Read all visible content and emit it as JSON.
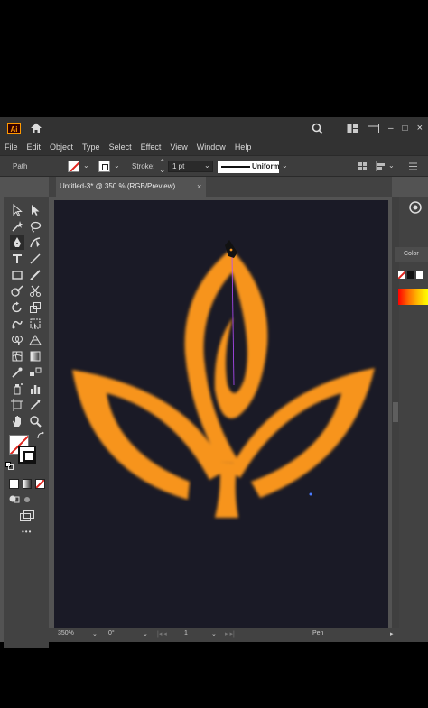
{
  "app": {
    "logo_text": "Ai",
    "icons": [
      "home-icon",
      "search-icon",
      "arrange-icon",
      "window-icon"
    ],
    "window_controls": [
      "–",
      "□",
      "×"
    ]
  },
  "menu": {
    "items": [
      "File",
      "Edit",
      "Object",
      "Type",
      "Select",
      "Effect",
      "View",
      "Window",
      "Help"
    ]
  },
  "control_bar": {
    "selection_label": "Path",
    "stroke_label": "Stroke:",
    "stroke_weight": "1 pt",
    "profile": "Uniform"
  },
  "document": {
    "tab_title": "Untitled-3* @ 350 % (RGB/Preview)",
    "close": "×"
  },
  "panels": {
    "color_title": "Color"
  },
  "tools": {
    "more": "•••"
  },
  "status": {
    "zoom": "350%",
    "rotation": "0°",
    "artboard_number": "1",
    "tool_name": "Pen"
  },
  "colors": {
    "artwork_fill": "#f7941d",
    "artboard": "#1a1a26",
    "ui_dark": "#323232",
    "path_highlight": "#b44cff"
  }
}
